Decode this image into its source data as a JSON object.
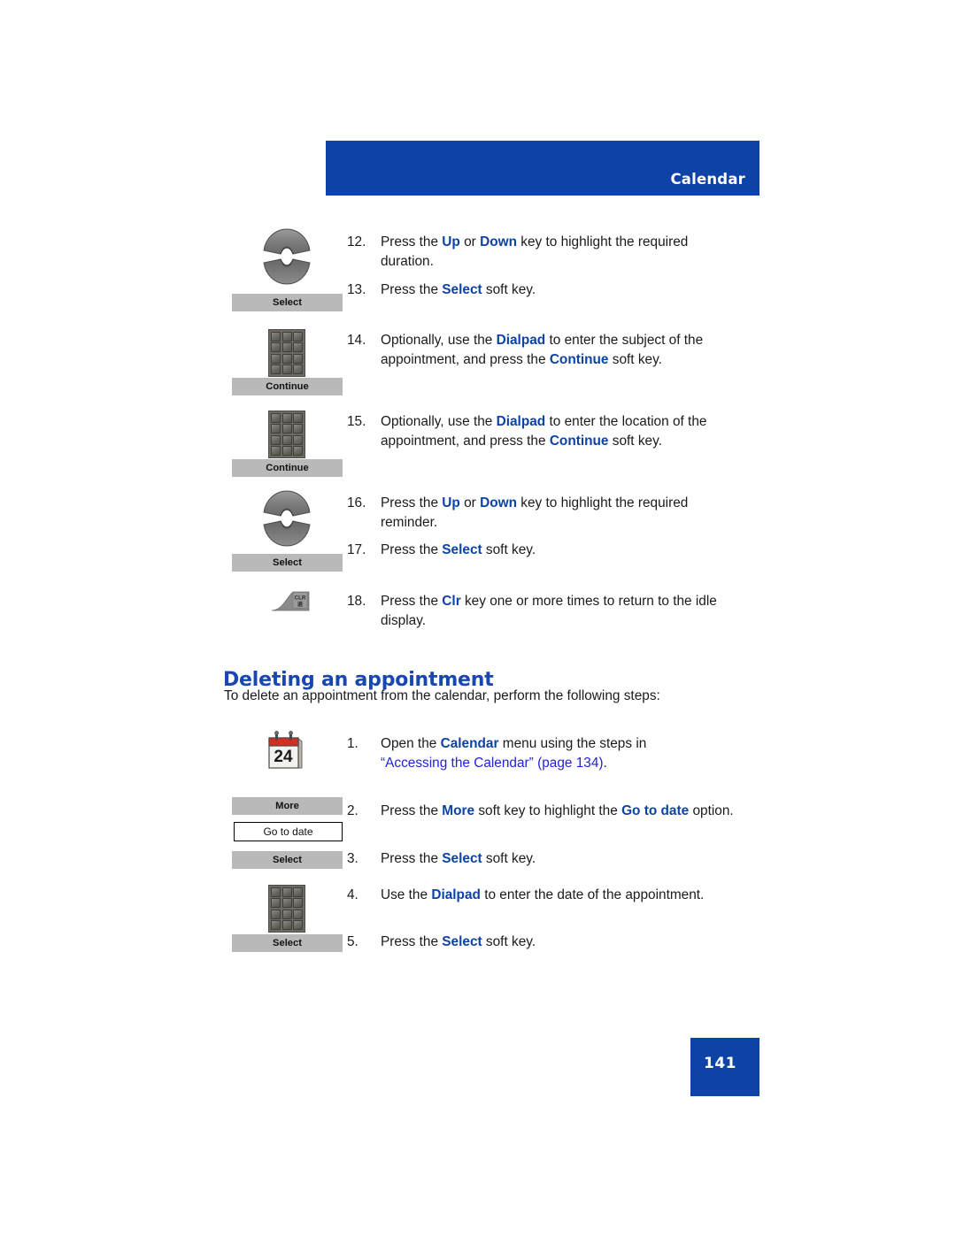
{
  "header": {
    "title": "Calendar",
    "band_color": "#0d43a6"
  },
  "colors": {
    "accent_blue": "#0d43a6",
    "heading_blue": "#1a46b0",
    "link_blue": "#2222dd",
    "softkey_gray": "#b9b9b9"
  },
  "continued_procedure": {
    "steps": [
      {
        "number": "12.",
        "icon": "navigation-updown-key-icon",
        "softkey_label": "Select",
        "text_runs": [
          {
            "t": "Press the ",
            "style": "normal"
          },
          {
            "t": "Up",
            "style": "bold-blue"
          },
          {
            "t": " or ",
            "style": "normal"
          },
          {
            "t": "Down",
            "style": "bold-blue"
          },
          {
            "t": " key to highlight the required duration.",
            "style": "normal"
          }
        ],
        "plain": "Press the Up or Down key to highlight the required duration."
      },
      {
        "number": "13.",
        "text_runs": [
          {
            "t": "Press the ",
            "style": "normal"
          },
          {
            "t": "Select",
            "style": "bold-blue"
          },
          {
            "t": " soft key.",
            "style": "normal"
          }
        ],
        "plain": "Press the Select soft key."
      },
      {
        "number": "14.",
        "icon": "dialpad-icon",
        "softkey_label": "Continue",
        "text_runs": [
          {
            "t": "Optionally, use the ",
            "style": "normal"
          },
          {
            "t": "Dialpad",
            "style": "bold-blue"
          },
          {
            "t": " to enter the subject of the appointment, and press the ",
            "style": "normal"
          },
          {
            "t": "Continue",
            "style": "bold-blue"
          },
          {
            "t": " soft key.",
            "style": "normal"
          }
        ],
        "plain": "Optionally, use the Dialpad to enter the subject of the appointment, and press the Continue soft key."
      },
      {
        "number": "15.",
        "icon": "dialpad-icon",
        "softkey_label": "Continue",
        "text_runs": [
          {
            "t": "Optionally, use the ",
            "style": "normal"
          },
          {
            "t": "Dialpad",
            "style": "bold-blue"
          },
          {
            "t": " to enter the location of the appointment, and press the ",
            "style": "normal"
          },
          {
            "t": "Continue",
            "style": "bold-blue"
          },
          {
            "t": " soft key.",
            "style": "normal"
          }
        ],
        "plain": "Optionally, use the Dialpad to enter the location of the appointment, and press the Continue soft key."
      },
      {
        "number": "16.",
        "icon": "navigation-updown-key-icon",
        "softkey_label": "Select",
        "text_runs": [
          {
            "t": "Press the ",
            "style": "normal"
          },
          {
            "t": "Up",
            "style": "bold-blue"
          },
          {
            "t": " or ",
            "style": "normal"
          },
          {
            "t": "Down",
            "style": "bold-blue"
          },
          {
            "t": " key to highlight the required reminder.",
            "style": "normal"
          }
        ],
        "plain": "Press the Up or Down key to highlight the required reminder."
      },
      {
        "number": "17.",
        "text_runs": [
          {
            "t": "Press the ",
            "style": "normal"
          },
          {
            "t": "Select",
            "style": "bold-blue"
          },
          {
            "t": " soft key.",
            "style": "normal"
          }
        ],
        "plain": "Press the Select soft key."
      },
      {
        "number": "18.",
        "icon": "clr-key-icon",
        "icon_label": "CLR",
        "text_runs": [
          {
            "t": "Press the ",
            "style": "normal"
          },
          {
            "t": "Clr",
            "style": "bold-blue"
          },
          {
            "t": " key one or more times to return to the idle display.",
            "style": "normal"
          }
        ],
        "plain": "Press the Clr key one or more times to return to the idle display."
      }
    ]
  },
  "section": {
    "heading": "Deleting an appointment",
    "lead": "To delete an appointment from the calendar, perform the following steps:",
    "steps": [
      {
        "number": "1.",
        "icon": "calendar-icon",
        "icon_text": "24",
        "line1_runs": [
          {
            "t": "Open the ",
            "style": "normal"
          },
          {
            "t": "Calendar",
            "style": "bold-blue"
          },
          {
            "t": " menu using the steps in",
            "style": "normal"
          }
        ],
        "line2_runs": [
          {
            "t": "“Accessing the Calendar” (page 134)",
            "style": "link"
          },
          {
            "t": ".",
            "style": "normal"
          }
        ],
        "plain": "Open the Calendar menu using the steps in “Accessing the Calendar” (page 134)."
      },
      {
        "number": "2.",
        "softkey_label": "More",
        "optionbox_label": "Go to date",
        "text_runs": [
          {
            "t": "Press the ",
            "style": "normal"
          },
          {
            "t": "More",
            "style": "bold-blue"
          },
          {
            "t": " soft key to highlight the ",
            "style": "normal"
          },
          {
            "t": "Go to date",
            "style": "bold-blue"
          },
          {
            "t": " option.",
            "style": "normal"
          }
        ],
        "plain": "Press the More soft key to highlight the Go to date option."
      },
      {
        "number": "3.",
        "softkey_label": "Select",
        "text_runs": [
          {
            "t": "Press the ",
            "style": "normal"
          },
          {
            "t": "Select",
            "style": "bold-blue"
          },
          {
            "t": " soft key.",
            "style": "normal"
          }
        ],
        "plain": "Press the Select soft key."
      },
      {
        "number": "4.",
        "icon": "dialpad-icon",
        "text_runs": [
          {
            "t": "Use the ",
            "style": "normal"
          },
          {
            "t": "Dialpad",
            "style": "bold-blue"
          },
          {
            "t": " to enter the date of the appointment.",
            "style": "normal"
          }
        ],
        "plain": "Use the Dialpad to enter the date of the appointment."
      },
      {
        "number": "5.",
        "softkey_label": "Select",
        "text_runs": [
          {
            "t": "Press the ",
            "style": "normal"
          },
          {
            "t": "Select",
            "style": "bold-blue"
          },
          {
            "t": " soft key.",
            "style": "normal"
          }
        ],
        "plain": "Press the Select soft key."
      }
    ]
  },
  "footer": {
    "page_number": "141"
  }
}
